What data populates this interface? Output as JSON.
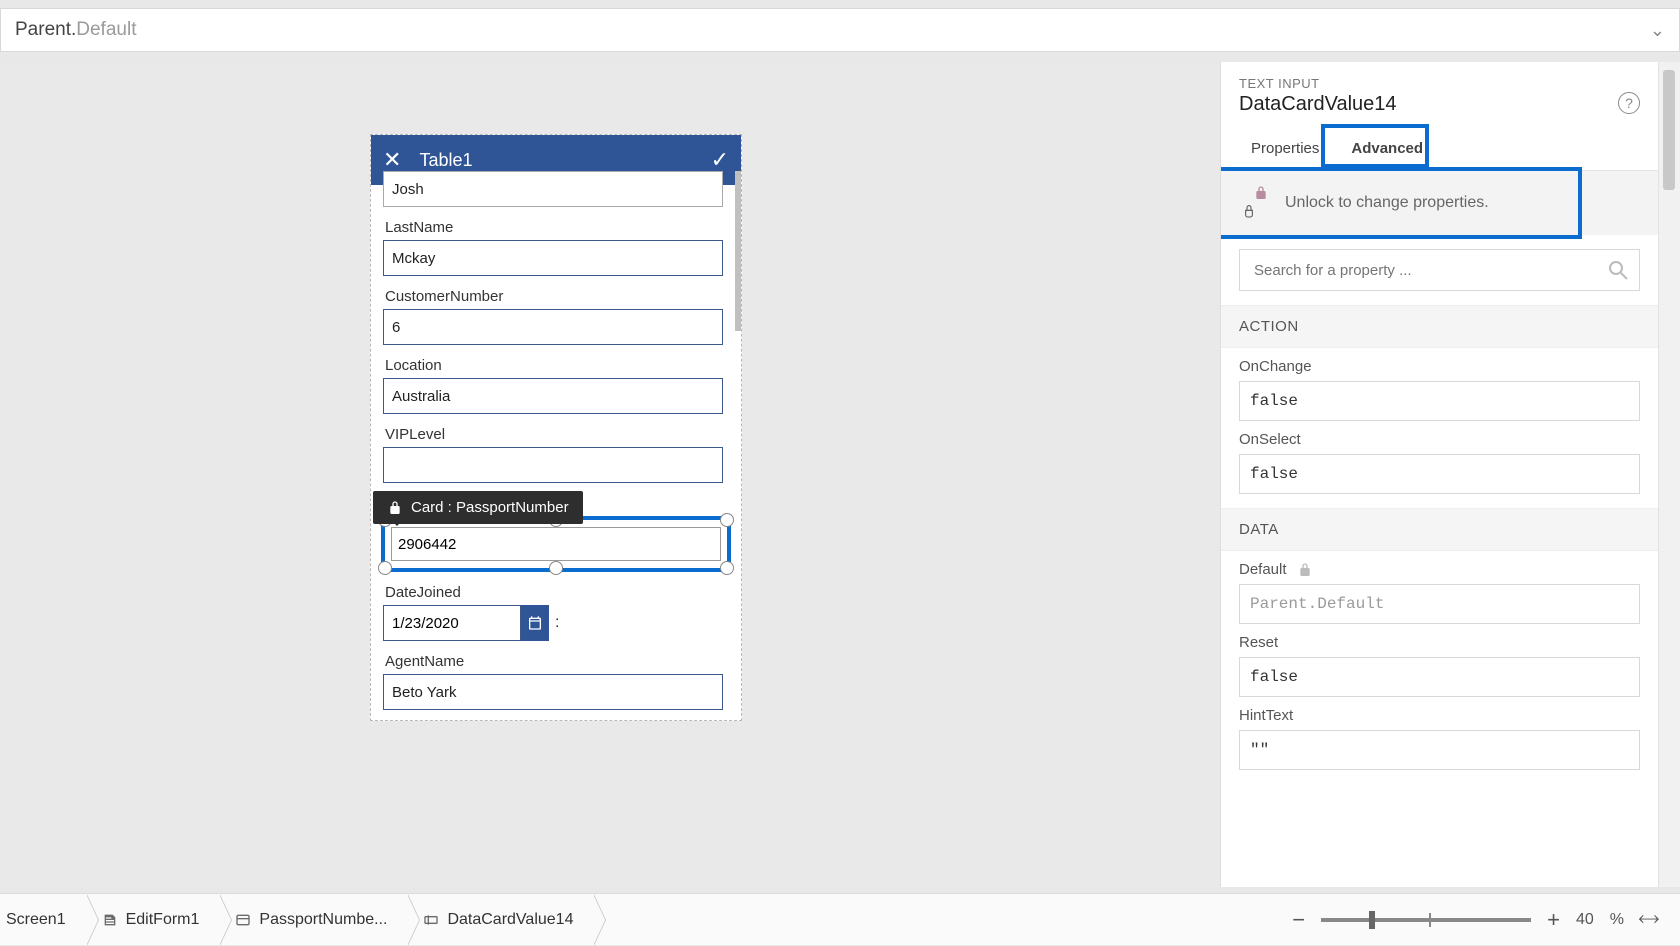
{
  "formula": {
    "pre": "Parent.",
    "post": "Default"
  },
  "phone": {
    "title": "Table1",
    "fields": {
      "firstnameVal": "Josh",
      "lastname": "LastName",
      "lastnameVal": "Mckay",
      "custnum": "CustomerNumber",
      "custnumVal": "6",
      "location": "Location",
      "locationVal": "Australia",
      "vip": "VIPLevel",
      "tooltip": "Card : PassportNumber",
      "passport": "PassportNumber",
      "passportVal": "2906442",
      "datejoined": "DateJoined",
      "datejoinedVal": "1/23/2020",
      "agent": "AgentName",
      "agentVal": "Beto Yark"
    }
  },
  "panel": {
    "type": "TEXT INPUT",
    "name": "DataCardValue14",
    "tabs": {
      "properties": "Properties",
      "advanced": "Advanced"
    },
    "unlock": "Unlock to change properties.",
    "searchPlaceholder": "Search for a property ...",
    "sections": {
      "action": "ACTION",
      "data": "DATA"
    },
    "props": {
      "onchange": {
        "label": "OnChange",
        "value": "false"
      },
      "onselect": {
        "label": "OnSelect",
        "value": "false"
      },
      "default": {
        "label": "Default",
        "value": "Parent.Default"
      },
      "reset": {
        "label": "Reset",
        "value": "false"
      },
      "hint": {
        "label": "HintText",
        "value": "\"\""
      }
    }
  },
  "bottom": {
    "crumb1": "Screen1",
    "crumb2": "EditForm1",
    "crumb3": "PassportNumbe...",
    "crumb4": "DataCardValue14",
    "zoomPct": "40",
    "zoomUnit": "%"
  }
}
